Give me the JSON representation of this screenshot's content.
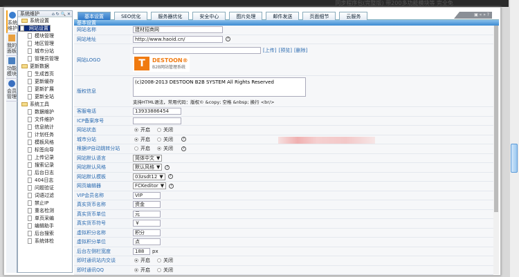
{
  "background_title": "同步程序包(完整版) 带200多功能模块等 完全免",
  "vtabs": [
    "系统维护",
    "我的面板",
    "功能模块",
    "会员管理"
  ],
  "tree": {
    "title": "系统维护",
    "tools": "⌂ ↻ 🔍 ✕",
    "groups": [
      {
        "label": "系统设置",
        "items": [
          "网站设置",
          "模块管理",
          "地区管理",
          "城市分站",
          "管理员管理"
        ]
      },
      {
        "label": "更新数据",
        "items": [
          "生成首页",
          "更新缓存",
          "更新扩展",
          "更新全站"
        ]
      },
      {
        "label": "系统工具",
        "items": [
          "数据维护",
          "文件维护",
          "信息统计",
          "计划任务",
          "模板风格",
          "标签向导",
          "上传记录",
          "搜索记录",
          "后台日志",
          "404日志",
          "问题验证",
          "词语过滤",
          "禁止IP",
          "重名检测",
          "单页采编",
          "编辑助手",
          "后台搜索",
          "系统体检"
        ]
      }
    ]
  },
  "tabs": [
    "基本设置",
    "SEO优化",
    "服务器优化",
    "安全中心",
    "图片处理",
    "邮件发送",
    "页面细节",
    "云服务"
  ],
  "window_tools": "▣ « » ?",
  "section_title": "基本设置",
  "form": {
    "site_name": {
      "label": "网站名称",
      "value": "建材招商网"
    },
    "site_url": {
      "label": "网站地址",
      "value": "http://www.haoid.cn/"
    },
    "logo": {
      "label": "网站LOGO",
      "value": "",
      "upload": "[上传]",
      "preview": "[预览]",
      "delete": "[删除]",
      "logo_brand": "DESTOON®",
      "logo_sub": "B2B网站管理系统"
    },
    "copyright": {
      "label": "版权信息",
      "value": "(c)2008-2013 DESTOON B2B SYSTEM All Rights Reserved",
      "hint": "支持HTML语法，常用代码：版权© &copy; 空格 &nbsp; 换行 <br/>"
    },
    "phone": {
      "label": "客服电话",
      "value": "13933886454"
    },
    "icp": {
      "label": "ICP备案序号",
      "value": ""
    },
    "status": {
      "label": "网站状态",
      "on": "开启",
      "off": "关闭"
    },
    "city": {
      "label": "城市分站",
      "on": "开启",
      "off": "关闭"
    },
    "ip_jump": {
      "label": "根据IP自动跳转分站",
      "on": "开启",
      "off": "关闭"
    },
    "language": {
      "label": "网站默认语言",
      "value": "简体中文"
    },
    "style": {
      "label": "网站默认风格",
      "value": "默认风格"
    },
    "template": {
      "label": "网站默认模板",
      "value": "03zsdt12"
    },
    "editor": {
      "label": "网页编辑器",
      "value": "FCKeditor"
    },
    "vip": {
      "label": "VIP会员名称",
      "value": "VIP"
    },
    "money_name": {
      "label": "真实货币名称",
      "value": "资金"
    },
    "money_unit": {
      "label": "真实货币单位",
      "value": "元"
    },
    "money_sign": {
      "label": "真实货币符号",
      "value": "￥"
    },
    "credit_name": {
      "label": "虚拟积分名称",
      "value": "积分"
    },
    "credit_unit": {
      "label": "虚拟积分单位",
      "value": "点"
    },
    "sidebar_width": {
      "label": "后台左侧栏宽度",
      "value": "188",
      "unit": "px"
    },
    "im_chat": {
      "label": "即时通讯站内交谈",
      "on": "开启",
      "off": "关闭"
    },
    "im_qq": {
      "label": "即时通讯QQ",
      "on": "开启",
      "off": "关闭"
    }
  },
  "help_glyph": "?",
  "select_arrow": "▼"
}
